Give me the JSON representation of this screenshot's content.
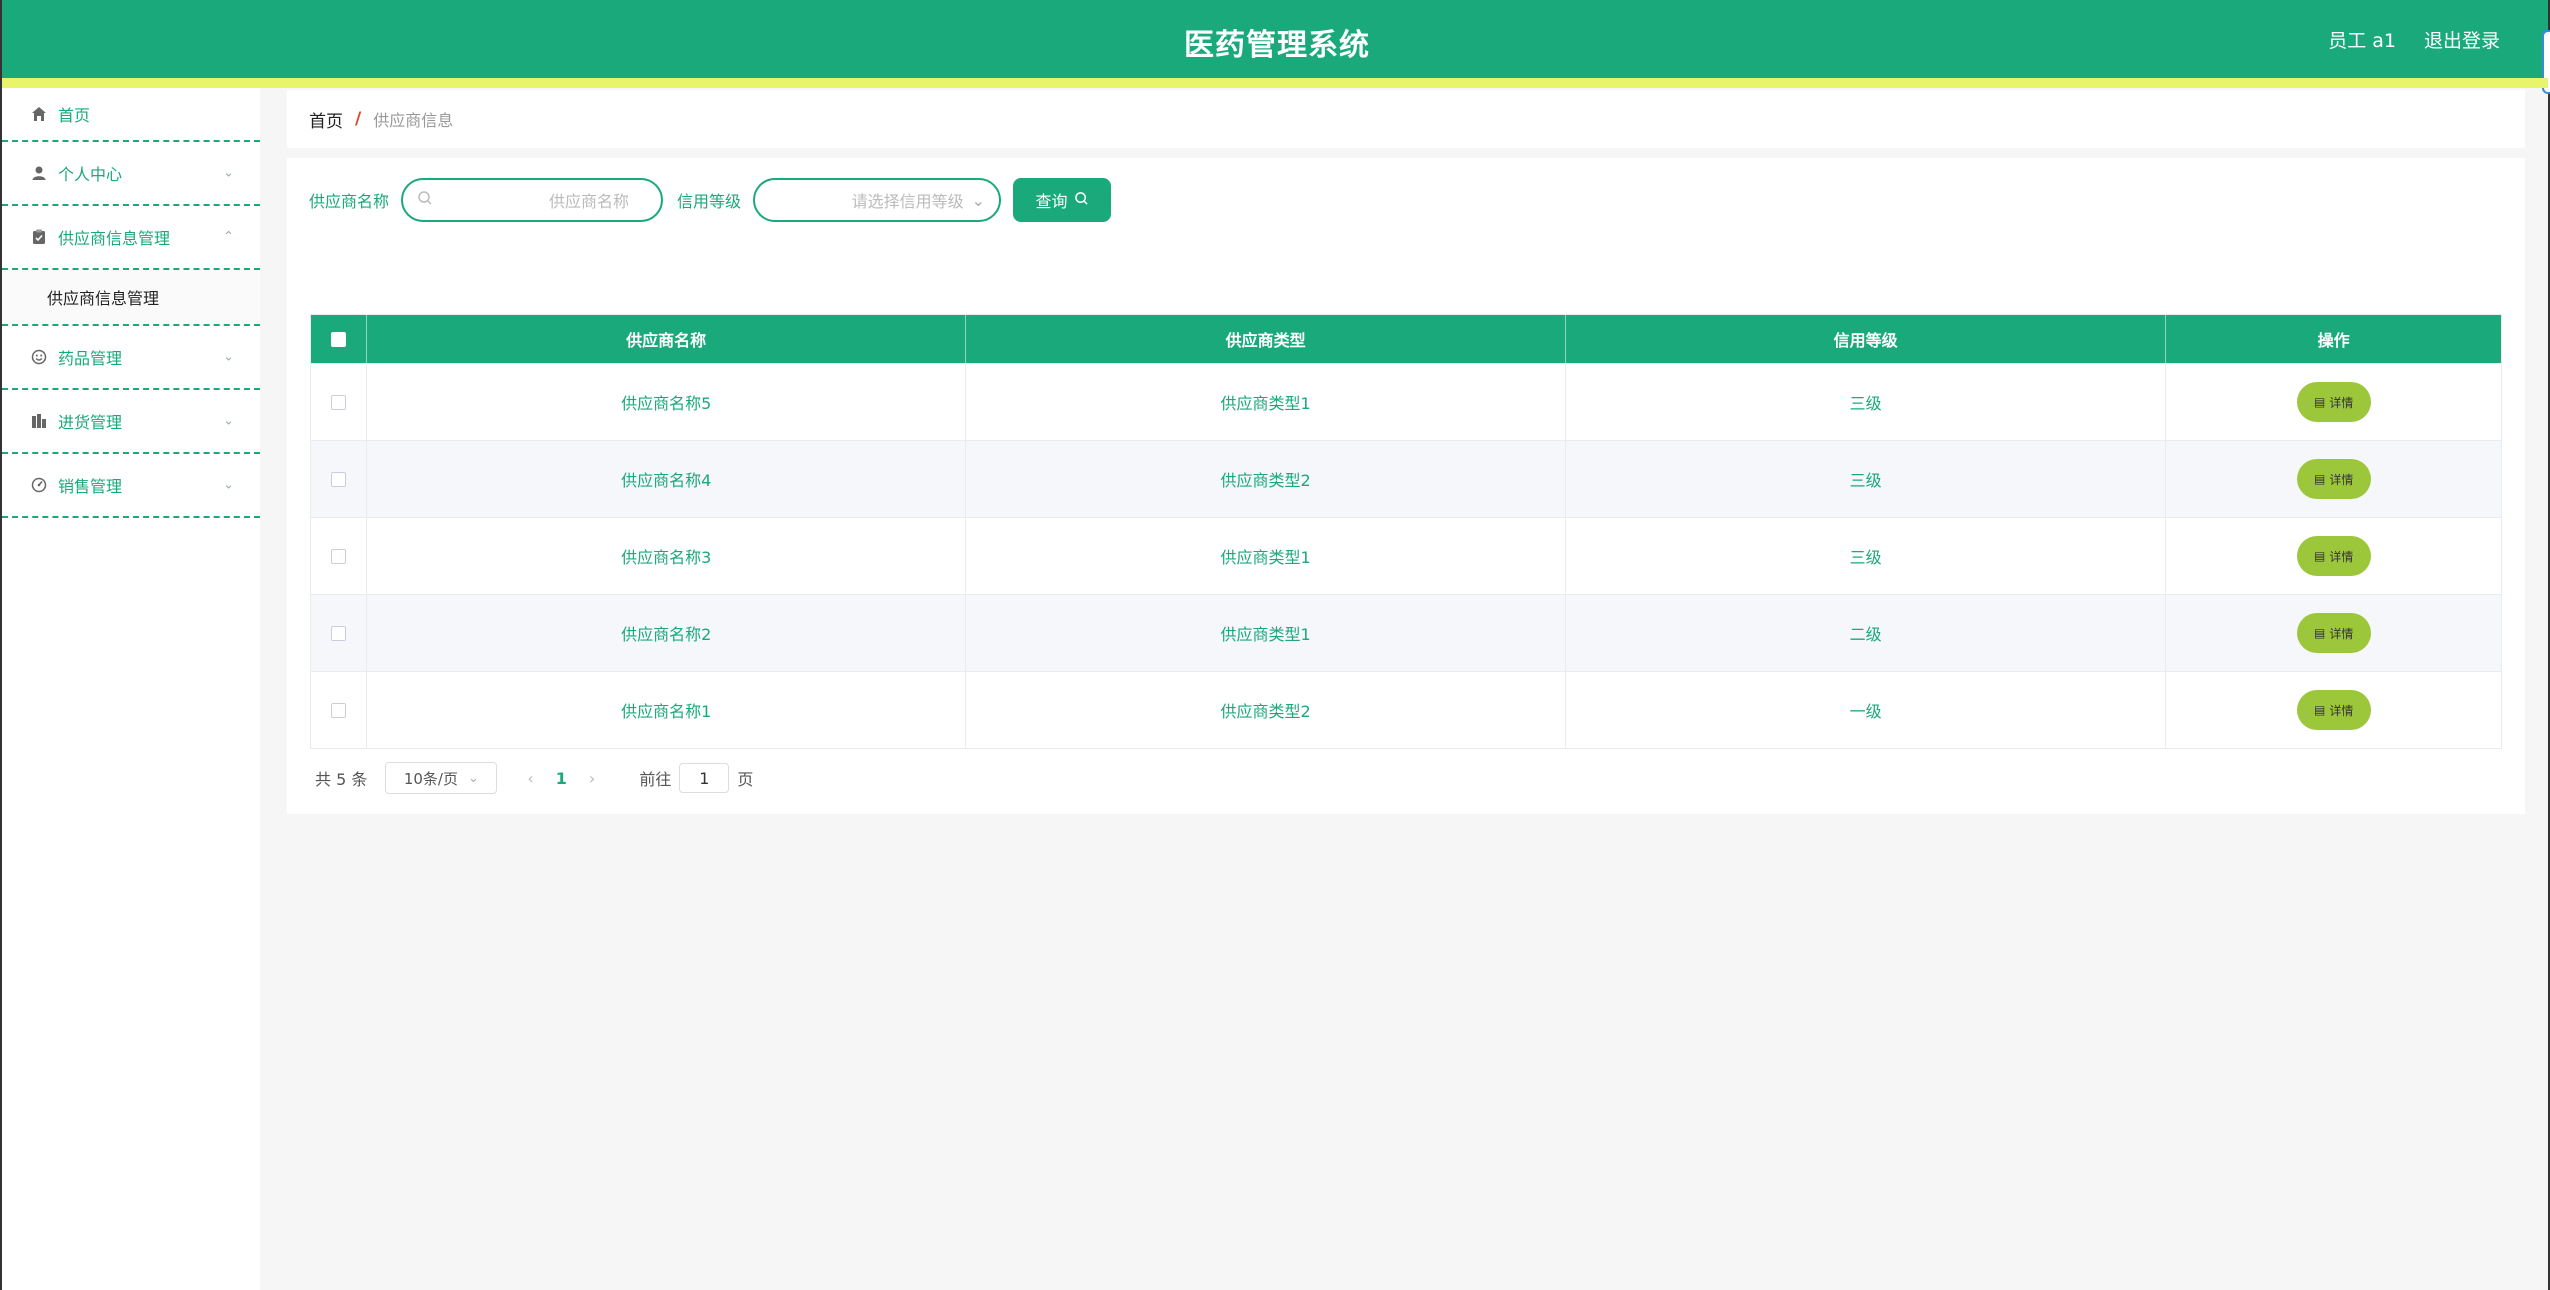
{
  "header": {
    "title": "医药管理系统",
    "user_label": "员工 a1",
    "logout_label": "退出登录"
  },
  "sidebar": {
    "items": [
      {
        "label": "首页",
        "icon": "home-icon"
      },
      {
        "label": "个人中心",
        "icon": "user-icon"
      },
      {
        "label": "供应商信息管理",
        "icon": "clipboard-icon",
        "expanded": true,
        "children": [
          {
            "label": "供应商信息管理"
          }
        ]
      },
      {
        "label": "药品管理",
        "icon": "smile-icon"
      },
      {
        "label": "进货管理",
        "icon": "bar-icon"
      },
      {
        "label": "销售管理",
        "icon": "gauge-icon"
      }
    ]
  },
  "breadcrumb": {
    "home": "首页",
    "separator": "/",
    "current": "供应商信息"
  },
  "search": {
    "name_label": "供应商名称",
    "name_placeholder": "供应商名称",
    "credit_label": "信用等级",
    "credit_placeholder": "请选择信用等级",
    "query_label": "查询"
  },
  "table": {
    "columns": [
      "供应商名称",
      "供应商类型",
      "信用等级",
      "操作"
    ],
    "rows": [
      {
        "name": "供应商名称5",
        "type": "供应商类型1",
        "credit": "三级",
        "action": "详情"
      },
      {
        "name": "供应商名称4",
        "type": "供应商类型2",
        "credit": "三级",
        "action": "详情"
      },
      {
        "name": "供应商名称3",
        "type": "供应商类型1",
        "credit": "三级",
        "action": "详情"
      },
      {
        "name": "供应商名称2",
        "type": "供应商类型1",
        "credit": "二级",
        "action": "详情"
      },
      {
        "name": "供应商名称1",
        "type": "供应商类型2",
        "credit": "一级",
        "action": "详情"
      }
    ]
  },
  "pagination": {
    "total_text": "共 5 条",
    "page_size": "10条/页",
    "current_page": "1",
    "goto_label": "前往",
    "goto_value": "1",
    "page_suffix": "页"
  },
  "colors": {
    "primary": "#1aa97a",
    "accent_strip": "#e8f56b",
    "detail_button": "#9cc73a"
  }
}
